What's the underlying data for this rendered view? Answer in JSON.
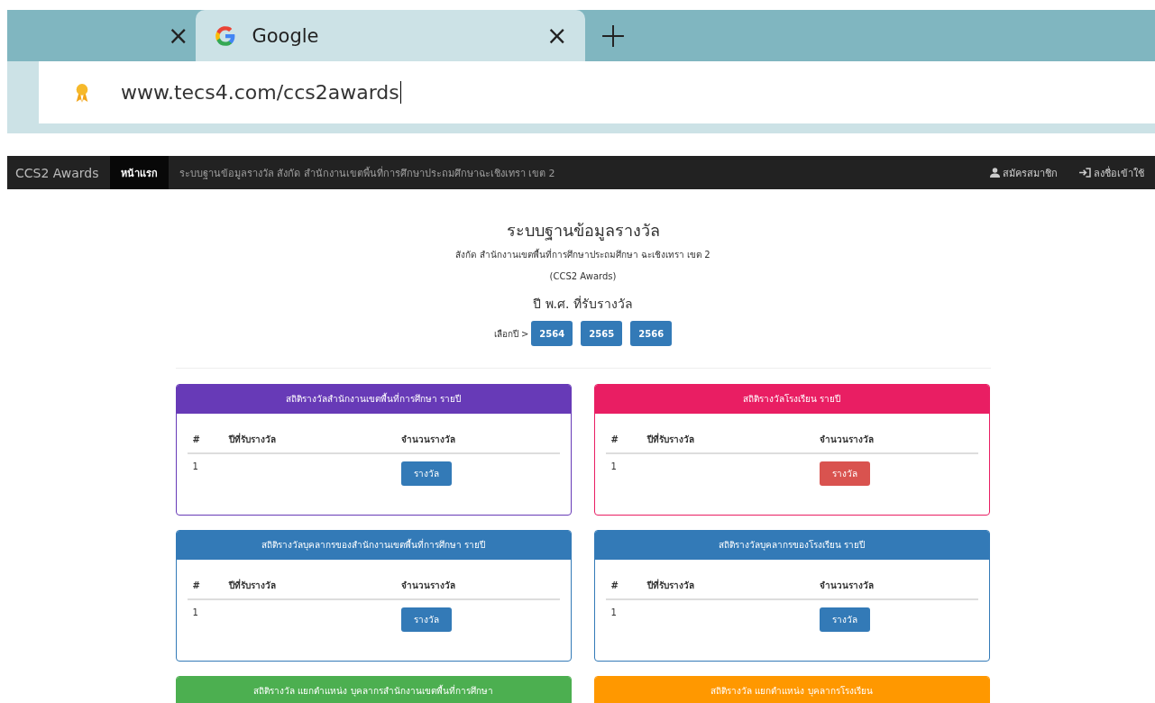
{
  "browser": {
    "tabs": [
      {
        "close": "×",
        "selected": false
      },
      {
        "title": "Google",
        "close": "×",
        "selected": true
      }
    ],
    "address": {
      "value": "www.tecs4.com/ccs2awards"
    }
  },
  "navbar": {
    "brand": "CCS2 Awards",
    "items": [
      {
        "label": "หน้าแรก",
        "selected": true
      },
      {
        "label": "ระบบฐานข้อมูลรางวัล สังกัด สำนักงานเขตพื้นที่การศึกษาประถมศึกษาฉะเชิงเทรา เขต 2",
        "selected": false
      }
    ],
    "right_items": [
      {
        "label": "สมัครสมาชิก",
        "kind": "user"
      },
      {
        "label": "ลงชื่อเข้าใช้",
        "kind": "login"
      }
    ]
  },
  "header": {
    "title": "ระบบฐานข้อมูลรางวัล",
    "subtitle": "สังกัด สำนักงานเขตพื้นที่การศึกษาประถมศึกษา ฉะเชิงเทรา เขต 2",
    "tagline": "(CCS2 Awards)",
    "year_heading": "ปี พ.ศ. ที่รับรางวัล",
    "year_prompt": "เลือกปี >",
    "years": [
      "2564",
      "2565",
      "2566"
    ]
  },
  "panels": [
    {
      "title": "สถิติรางวัลสำนักงานเขตพื้นที่การศึกษา รายปี",
      "color": "#673ab7",
      "columns": [
        "#",
        "ปีที่รับรางวัล",
        "จำนวนรางวัล"
      ],
      "rows": [
        {
          "number": "1",
          "button": {
            "label": "รางวัล",
            "kind": "primary"
          }
        }
      ]
    },
    {
      "title": "สถิติรางวัลโรงเรียน รายปี",
      "color": "#e91e63",
      "columns": [
        "#",
        "ปีที่รับรางวัล",
        "จำนวนรางวัล"
      ],
      "rows": [
        {
          "number": "1",
          "button": {
            "label": "รางวัล",
            "kind": "danger"
          }
        }
      ]
    },
    {
      "title": "สถิติรางวัลบุคลากรของสำนักงานเขตพื้นที่การศึกษา รายปี",
      "color": "#337ab7",
      "columns": [
        "#",
        "ปีที่รับรางวัล",
        "จำนวนรางวัล"
      ],
      "rows": [
        {
          "number": "1",
          "button": {
            "label": "รางวัล",
            "kind": "primary"
          }
        }
      ]
    },
    {
      "title": "สถิติรางวัลบุคลากรของโรงเรียน รายปี",
      "color": "#337ab7",
      "columns": [
        "#",
        "ปีที่รับรางวัล",
        "จำนวนรางวัล"
      ],
      "rows": [
        {
          "number": "1",
          "button": {
            "label": "รางวัล",
            "kind": "primary"
          }
        }
      ]
    },
    {
      "title": "สถิติรางวัล แยกตำแหน่ง บุคลากรสำนักงานเขตพื้นที่การศึกษา",
      "color": "#4caf50"
    },
    {
      "title": "สถิติรางวัล แยกตำแหน่ง บุคลากรโรงเรียน",
      "color": "#ff9800"
    }
  ]
}
